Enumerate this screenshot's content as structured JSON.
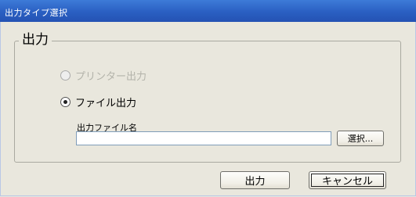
{
  "window": {
    "title": "出力タイプ選択"
  },
  "group": {
    "label": "出力"
  },
  "options": {
    "printer": {
      "label": "プリンター出力",
      "enabled": false,
      "selected": false
    },
    "file": {
      "label": "ファイル出力",
      "enabled": true,
      "selected": true
    }
  },
  "file_output": {
    "label": "出力ファイル名",
    "value": "",
    "browse_label": "選択..."
  },
  "buttons": {
    "output_label": "出力",
    "cancel_label": "キャンセル"
  },
  "colors": {
    "titlebar": "#2a5fc2",
    "dialog_bg": "#e9e7dd",
    "disabled_text": "#b3b3aa"
  }
}
